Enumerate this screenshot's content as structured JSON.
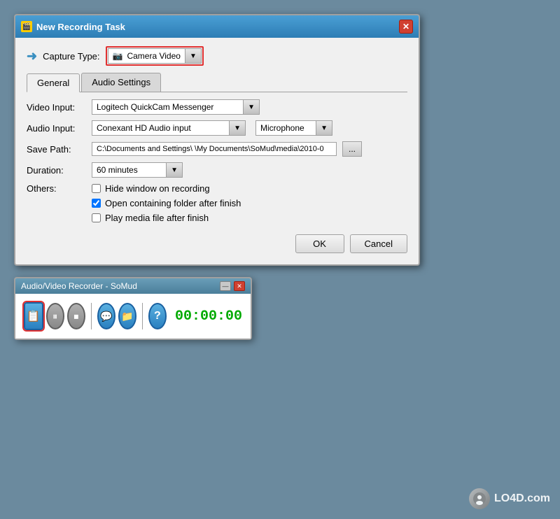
{
  "dialog": {
    "title": "New Recording Task",
    "close_btn": "✕",
    "capture_type_label": "Capture Type:",
    "capture_type_value": "Camera Video",
    "tabs": [
      {
        "label": "General",
        "active": true
      },
      {
        "label": "Audio Settings",
        "active": false
      }
    ],
    "form": {
      "video_input_label": "Video Input:",
      "video_input_value": "Logitech QuickCam Messenger",
      "audio_input_label": "Audio Input:",
      "audio_input_value": "Conexant HD Audio input",
      "audio_input_secondary": "Microphone",
      "save_path_label": "Save Path:",
      "save_path_value": "C:\\Documents and Settings\\   \\My Documents\\SoMud\\media\\2010-0",
      "browse_btn": "...",
      "duration_label": "Duration:",
      "duration_value": "60 minutes",
      "others_label": "Others:",
      "checkbox1_label": "Hide window on recording",
      "checkbox1_checked": false,
      "checkbox2_label": "Open containing folder after finish",
      "checkbox2_checked": true,
      "checkbox3_label": "Play media file after finish",
      "checkbox3_checked": false
    },
    "ok_btn": "OK",
    "cancel_btn": "Cancel"
  },
  "recorder": {
    "title": "Audio/Video Recorder - SoMud",
    "timer": "00:00:00",
    "minimize_btn": "—",
    "close_btn": "✕"
  },
  "watermark": {
    "text": "LO4D.com",
    "logo": "lo4d"
  }
}
